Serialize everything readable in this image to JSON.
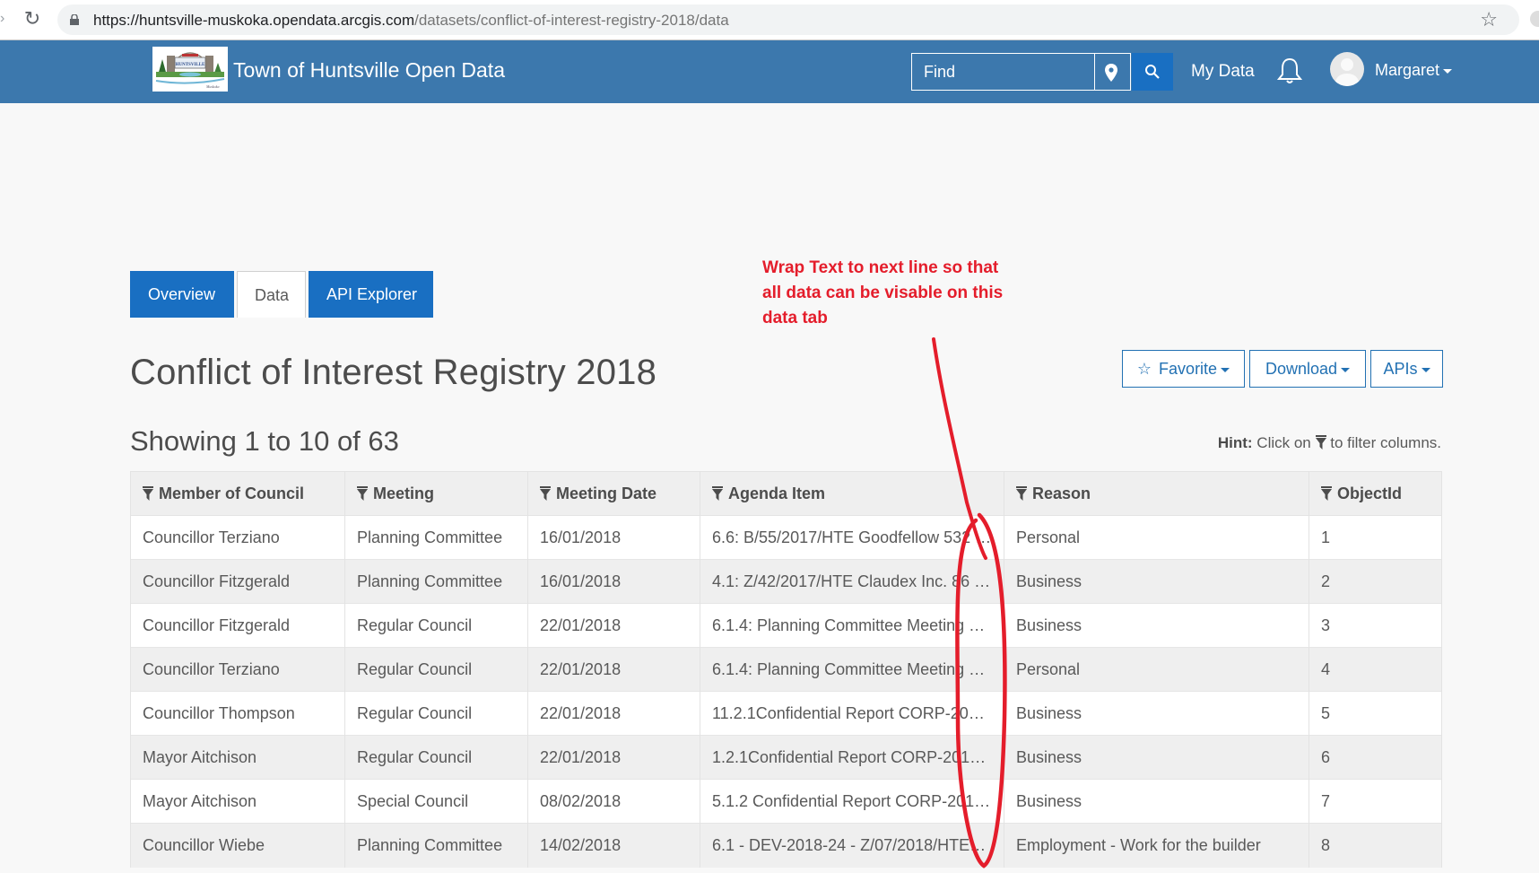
{
  "browser": {
    "url_host": "https://huntsville-muskoka.opendata.arcgis.com",
    "url_path": "/datasets/conflict-of-interest-registry-2018/data"
  },
  "header": {
    "site_title": "Town of Huntsville Open Data",
    "search_placeholder": "Find",
    "my_data_label": "My Data",
    "username": "Margaret",
    "brand_color": "#3c78ad",
    "accent_color": "#196fc2"
  },
  "tabs": [
    {
      "label": "Overview",
      "active": false
    },
    {
      "label": "Data",
      "active": true
    },
    {
      "label": "API Explorer",
      "active": false
    }
  ],
  "page": {
    "title": "Conflict of Interest Registry 2018",
    "showing": "Showing 1 to 10 of 63",
    "hint_bold": "Hint:",
    "hint_pre": "Click on",
    "hint_post": "to filter columns."
  },
  "actions": {
    "favorite": "Favorite",
    "download": "Download",
    "apis": "APIs"
  },
  "table": {
    "columns": [
      "Member of Council",
      "Meeting",
      "Meeting Date",
      "Agenda Item",
      "Reason",
      "ObjectId"
    ],
    "rows": [
      [
        "Councillor Terziano",
        "Planning Committee",
        "16/01/2018",
        "6.6: B/55/2017/HTE Goodfellow 532 …",
        "Personal",
        "1"
      ],
      [
        "Councillor Fitzgerald",
        "Planning Committee",
        "16/01/2018",
        "4.1: Z/42/2017/HTE Claudex Inc. 86 …",
        "Business",
        "2"
      ],
      [
        "Councillor Fitzgerald",
        "Regular Council",
        "22/01/2018",
        "6.1.4: Planning Committee Meeting …",
        "Business",
        "3"
      ],
      [
        "Councillor Terziano",
        "Regular Council",
        "22/01/2018",
        "6.1.4: Planning Committee Meeting …",
        "Personal",
        "4"
      ],
      [
        "Councillor Thompson",
        "Regular Council",
        "22/01/2018",
        "11.2.1Confidential Report CORP-201…",
        "Business",
        "5"
      ],
      [
        "Mayor Aitchison",
        "Regular Council",
        "22/01/2018",
        "1.2.1Confidential Report CORP-2018…",
        "Business",
        "6"
      ],
      [
        "Mayor Aitchison",
        "Special Council",
        "08/02/2018",
        "5.1.2 Confidential Report CORP-201…",
        "Business",
        "7"
      ],
      [
        "Councillor Wiebe",
        "Planning Committee",
        "14/02/2018",
        "6.1 - DEV-2018-24 - Z/07/2018/HTE…",
        "Employment - Work for the builder",
        "8"
      ]
    ]
  },
  "annotation": {
    "text": "Wrap Text to next line so that all data can be visable on this data tab",
    "color": "#e41d2b"
  }
}
